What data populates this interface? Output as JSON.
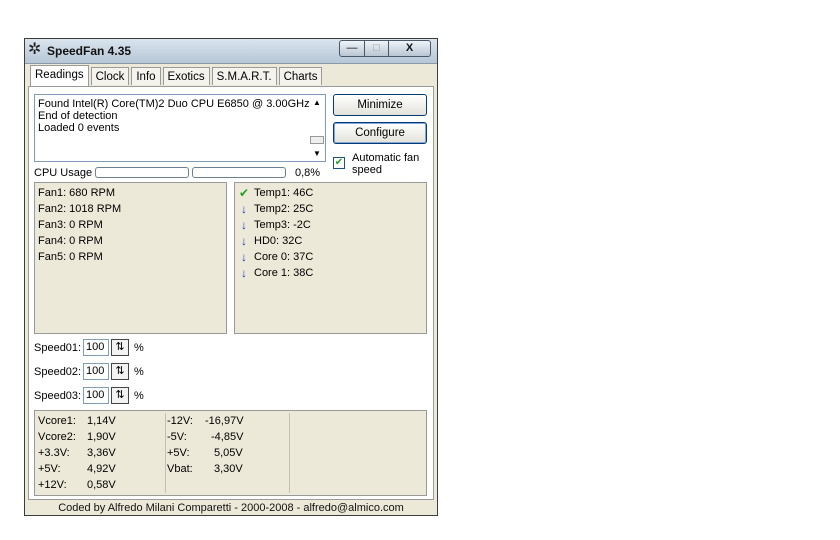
{
  "window": {
    "title": "SpeedFan 4.35",
    "minimize_glyph": "—",
    "maximize_glyph": "□",
    "close_glyph": "X"
  },
  "tabs": [
    "Readings",
    "Clock",
    "Info",
    "Exotics",
    "S.M.A.R.T.",
    "Charts"
  ],
  "log": [
    "Found Intel(R) Core(TM)2 Duo CPU E6850 @ 3.00GHz",
    "End of detection",
    "Loaded 0 events"
  ],
  "buttons": {
    "minimize": "Minimize",
    "configure": "Configure"
  },
  "auto_fan": {
    "label": "Automatic fan speed",
    "checked": true
  },
  "cpu": {
    "label": "CPU Usage",
    "value": "0,8%",
    "bar1_fraction": 0.0,
    "bar2_fraction": 0.0
  },
  "fans": [
    "Fan1: 680 RPM",
    "Fan2: 1018 RPM",
    "Fan3: 0 RPM",
    "Fan4: 0 RPM",
    "Fan5: 0 RPM"
  ],
  "temps": [
    {
      "label": "Temp1: 46C",
      "icon": "check-icon"
    },
    {
      "label": "Temp2: 25C",
      "icon": "arrow-down-icon"
    },
    {
      "label": "Temp3: -2C",
      "icon": "arrow-down-icon"
    },
    {
      "label": "HD0:    32C",
      "icon": "arrow-down-icon"
    },
    {
      "label": "Core 0:  37C",
      "icon": "arrow-down-icon"
    },
    {
      "label": "Core 1:  38C",
      "icon": "arrow-down-icon"
    }
  ],
  "speeds": [
    {
      "label": "Speed01:",
      "value": "100",
      "unit": "%"
    },
    {
      "label": "Speed02:",
      "value": "100",
      "unit": "%"
    },
    {
      "label": "Speed03:",
      "value": "100",
      "unit": "%"
    }
  ],
  "voltages_left": [
    {
      "label": "Vcore1:",
      "value": "1,14V"
    },
    {
      "label": "Vcore2:",
      "value": "1,90V"
    },
    {
      "label": "+3.3V:",
      "value": "3,36V"
    },
    {
      "label": "+5V:",
      "value": "4,92V"
    },
    {
      "label": "+12V:",
      "value": "0,58V"
    }
  ],
  "voltages_right": [
    {
      "label": "-12V:",
      "value": "-16,97V"
    },
    {
      "label": "-5V:",
      "value": "-4,85V"
    },
    {
      "label": "+5V:",
      "value": "5,05V"
    },
    {
      "label": "Vbat:",
      "value": "3,30V"
    }
  ],
  "footer": "Coded by Alfredo Milani Comparetti - 2000-2008 - alfredo@almico.com",
  "colors": {
    "check": "#21a121",
    "arrow": "#1a3fc4",
    "window_bg": "#ece9d8"
  }
}
